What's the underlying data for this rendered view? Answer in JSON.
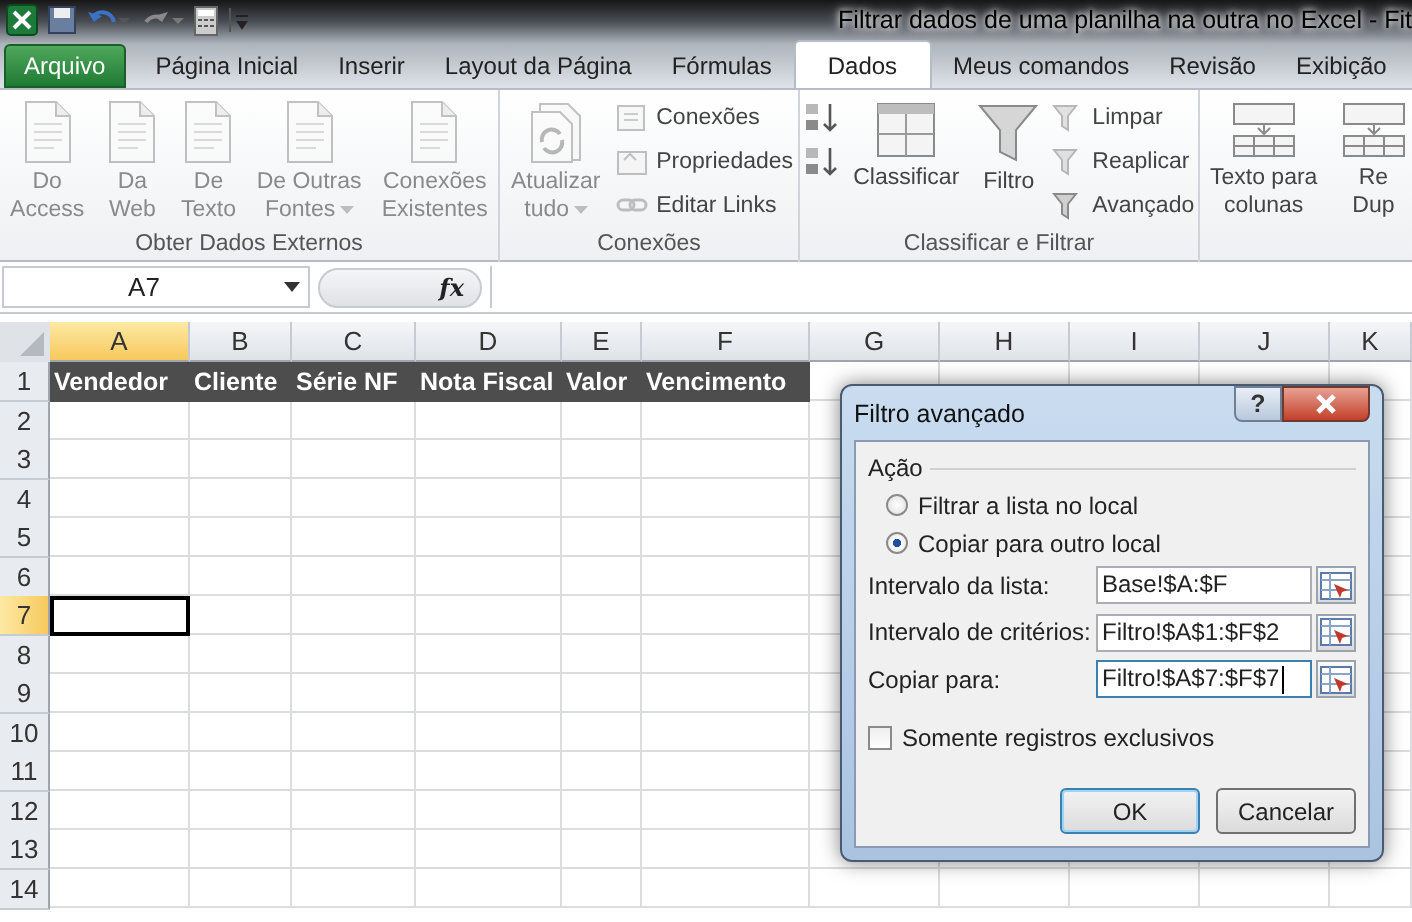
{
  "title_bar": {
    "title": "Filtrar dados de uma planilha na outra no Excel - Fit"
  },
  "ribbon_tabs": [
    {
      "label": "Arquivo",
      "kind": "file",
      "selected": false
    },
    {
      "label": "Página Inicial",
      "kind": "tab",
      "selected": false
    },
    {
      "label": "Inserir",
      "kind": "tab",
      "selected": false
    },
    {
      "label": "Layout da Página",
      "kind": "tab",
      "selected": false
    },
    {
      "label": "Fórmulas",
      "kind": "tab",
      "selected": false
    },
    {
      "label": "Dados",
      "kind": "tab",
      "selected": true
    },
    {
      "label": "Meus comandos",
      "kind": "tab",
      "selected": false
    },
    {
      "label": "Revisão",
      "kind": "tab",
      "selected": false
    },
    {
      "label": "Exibição",
      "kind": "tab",
      "selected": false
    }
  ],
  "ribbon_groups": [
    {
      "label": "Obter Dados Externos",
      "items": [
        {
          "kind": "large",
          "lines": [
            "Do",
            "Access"
          ],
          "dropdown": false,
          "disabled": true
        },
        {
          "kind": "large",
          "lines": [
            "Da",
            "Web"
          ],
          "dropdown": false,
          "disabled": true
        },
        {
          "kind": "large",
          "lines": [
            "De",
            "Texto"
          ],
          "dropdown": false,
          "disabled": true
        },
        {
          "kind": "large",
          "lines": [
            "De Outras",
            "Fontes"
          ],
          "dropdown": true,
          "disabled": true
        },
        {
          "kind": "large",
          "lines": [
            "Conexões",
            "Existentes"
          ],
          "dropdown": false,
          "disabled": true
        }
      ]
    },
    {
      "label": "Conexões",
      "items": [
        {
          "kind": "large",
          "lines": [
            "Atualizar",
            "tudo"
          ],
          "dropdown": true,
          "disabled": true
        },
        {
          "kind": "stack",
          "items": [
            {
              "label": "Conexões",
              "disabled": true
            },
            {
              "label": "Propriedades",
              "disabled": true
            },
            {
              "label": "Editar Links",
              "disabled": true
            }
          ]
        }
      ]
    },
    {
      "label": "Classificar e Filtrar",
      "items": [
        {
          "kind": "stack",
          "items": [
            {
              "disabled": false
            },
            {
              "disabled": false
            }
          ]
        },
        {
          "kind": "large",
          "lines": [
            "Classificar"
          ],
          "dropdown": false,
          "disabled": false
        },
        {
          "kind": "large",
          "lines": [
            "Filtro"
          ],
          "dropdown": false,
          "disabled": false
        },
        {
          "kind": "stack",
          "items": [
            {
              "label": "Limpar",
              "disabled": true
            },
            {
              "label": "Reaplicar",
              "disabled": true
            },
            {
              "label": "Avançado",
              "disabled": false
            }
          ]
        }
      ]
    },
    {
      "items": [
        {
          "kind": "large",
          "lines": [
            "Texto para",
            "colunas"
          ],
          "dropdown": false,
          "disabled": false
        },
        {
          "kind": "large",
          "lines": [
            "Re",
            "Dup"
          ],
          "dropdown": false,
          "disabled": false
        }
      ]
    }
  ],
  "formula_bar": {
    "name_box": "A7",
    "function_label": "fx"
  },
  "sheet": {
    "columns": [
      {
        "label": "A",
        "selected": true
      },
      {
        "label": "B",
        "selected": false
      },
      {
        "label": "C",
        "selected": false
      },
      {
        "label": "D",
        "selected": false
      },
      {
        "label": "E",
        "selected": false
      },
      {
        "label": "F",
        "selected": false
      },
      {
        "label": "G",
        "selected": false
      },
      {
        "label": "H",
        "selected": false
      },
      {
        "label": "I",
        "selected": false
      },
      {
        "label": "J",
        "selected": false
      },
      {
        "label": "K",
        "selected": false
      }
    ],
    "rows": [
      {
        "label": "1",
        "selected": false
      },
      {
        "label": "2",
        "selected": false
      },
      {
        "label": "3",
        "selected": false
      },
      {
        "label": "4",
        "selected": false
      },
      {
        "label": "5",
        "selected": false
      },
      {
        "label": "6",
        "selected": false
      },
      {
        "label": "7",
        "selected": true
      },
      {
        "label": "8",
        "selected": false
      },
      {
        "label": "9",
        "selected": false
      },
      {
        "label": "10",
        "selected": false
      },
      {
        "label": "11",
        "selected": false
      },
      {
        "label": "12",
        "selected": false
      },
      {
        "label": "13",
        "selected": false
      },
      {
        "label": "14",
        "selected": false
      }
    ],
    "header_cells": [
      "Vendedor",
      "Cliente",
      "Série NF",
      "Nota Fiscal",
      "Valor",
      "Vencimento"
    ]
  },
  "dialog": {
    "title": "Filtro avançado",
    "help_label": "?",
    "section_label": "Ação",
    "options": [
      {
        "label": "Filtrar a lista no local",
        "selected": false
      },
      {
        "label": "Copiar para outro local",
        "selected": true
      }
    ],
    "fields": [
      {
        "label": "Intervalo da lista:",
        "value": "Base!$A:$F",
        "focused": false
      },
      {
        "label": "Intervalo de critérios:",
        "value": "Filtro!$A$1:$F$2",
        "focused": false
      },
      {
        "label": "Copiar para:",
        "value": "Filtro!$A$7:$F$7",
        "focused": true
      }
    ],
    "unique_only": {
      "label": "Somente registros exclusivos",
      "checked": false
    },
    "buttons": [
      {
        "label": "OK",
        "default": true
      },
      {
        "label": "Cancelar",
        "default": false
      }
    ]
  }
}
